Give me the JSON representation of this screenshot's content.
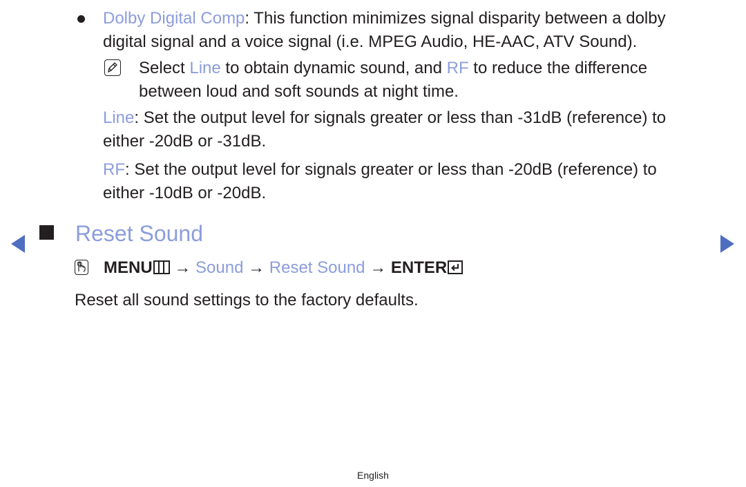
{
  "colors": {
    "accent": "#8c9ddc",
    "nav_arrow": "#4e6ec0",
    "text": "#231f20"
  },
  "dolby": {
    "term": "Dolby Digital Comp",
    "line1_rest": ": This function minimizes signal disparity between a dolby",
    "line2": "digital signal and a voice signal (i.e. MPEG Audio, HE-AAC, ATV Sound)."
  },
  "note": {
    "icon": "note-icon",
    "pre": "Select ",
    "term1": "Line",
    "mid": " to obtain dynamic sound, and ",
    "term2": "RF",
    "post": " to reduce the difference",
    "line2": "between loud and soft sounds at night time."
  },
  "line_desc": {
    "term": "Line",
    "line1_rest": ": Set the output level for signals greater or less than -31dB (reference) to",
    "line2": "either -20dB or -31dB."
  },
  "rf_desc": {
    "term": "RF",
    "line1_rest": ": Set the output level for signals greater or less than -20dB (reference) to",
    "line2": "either -10dB or -20dB."
  },
  "section": {
    "title": "Reset Sound",
    "menu_path": {
      "remote_icon": "remote-hand-icon",
      "menu": "MENU",
      "arrow": "→",
      "step1": "Sound",
      "step2": "Reset Sound",
      "enter": "ENTER"
    },
    "description": "Reset all sound settings to the factory defaults."
  },
  "nav": {
    "prev": "previous-page",
    "next": "next-page"
  },
  "footer": {
    "language": "English"
  }
}
